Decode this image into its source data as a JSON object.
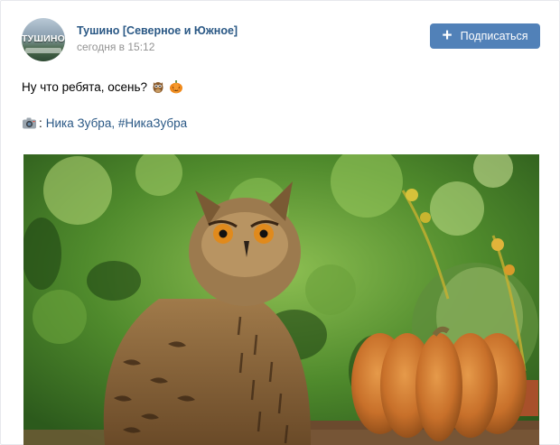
{
  "post": {
    "group_name": "Тушино [Северное и Южное]",
    "date": "сегодня в 15:12",
    "avatar_text": "ТУШИНО",
    "subscribe_label": "Подписаться",
    "subscribe_icon": "plus-icon",
    "text": "Ну что ребята, осень?",
    "text_emojis": [
      "owl-emoji",
      "pumpkin-emoji"
    ],
    "credit_icon": "camera-icon",
    "credit_colon": ":",
    "credit_author": "Ника Зубра",
    "credit_separator": ", ",
    "credit_hashtag": "#НикаЗубра",
    "photo_subject": "owl-and-pumpkin-photo"
  },
  "colors": {
    "link": "#2a5885",
    "button": "#5181b8",
    "date": "#939393"
  }
}
